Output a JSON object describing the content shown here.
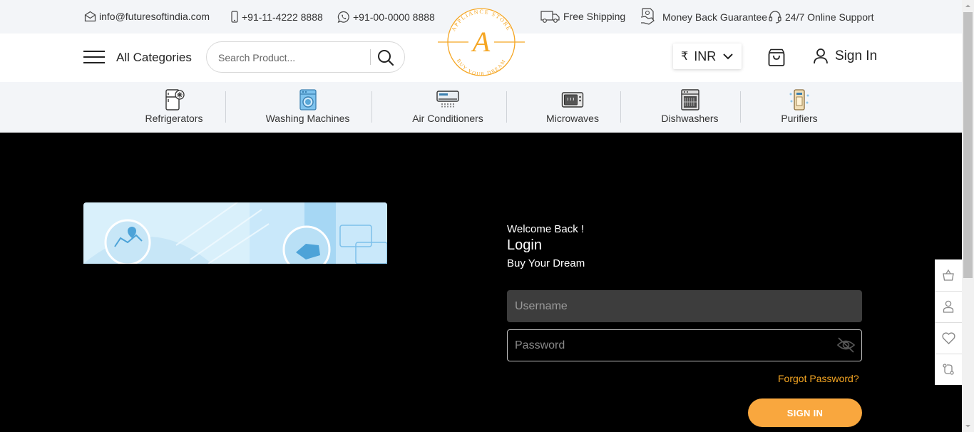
{
  "topbar": {
    "email": "info@futuresoftindia.com",
    "phone": "+91-11-4222 8888",
    "whatsapp": "+91-00-0000 8888",
    "free_shipping": "Free Shipping",
    "money_back": "Money Back Guarantee",
    "support": "24/7 Online Support"
  },
  "header": {
    "all_categories": "All Categories",
    "search_placeholder": "Search Product...",
    "currency_symbol": "₹",
    "currency_code": "INR",
    "sign_in": "Sign In"
  },
  "logo": {
    "letter": "A",
    "ring_top": "APPLIANCE STORE",
    "ring_bottom": "BUY YOUR DREAM",
    "color": "#f5a623"
  },
  "categories": [
    {
      "label": "Refrigerators",
      "icon": "refrigerator-icon"
    },
    {
      "label": "Washing Machines",
      "icon": "washing-machine-icon"
    },
    {
      "label": "Air Conditioners",
      "icon": "air-conditioner-icon"
    },
    {
      "label": "Microwaves",
      "icon": "microwave-icon"
    },
    {
      "label": "Dishwashers",
      "icon": "dishwasher-icon"
    },
    {
      "label": "Purifiers",
      "icon": "purifier-icon"
    }
  ],
  "login": {
    "welcome": "Welcome Back !",
    "title": "Login",
    "tagline": "Buy Your Dream",
    "username_placeholder": "Username",
    "password_placeholder": "Password",
    "forgot": "Forgot Password?",
    "submit": "SIGN IN"
  },
  "sidepanel": [
    "cart-icon",
    "user-icon",
    "heart-icon",
    "compare-icon"
  ],
  "colors": {
    "accent": "#f9a73e",
    "topbar_bg": "#f3f5f8",
    "page_bg": "#000000"
  }
}
